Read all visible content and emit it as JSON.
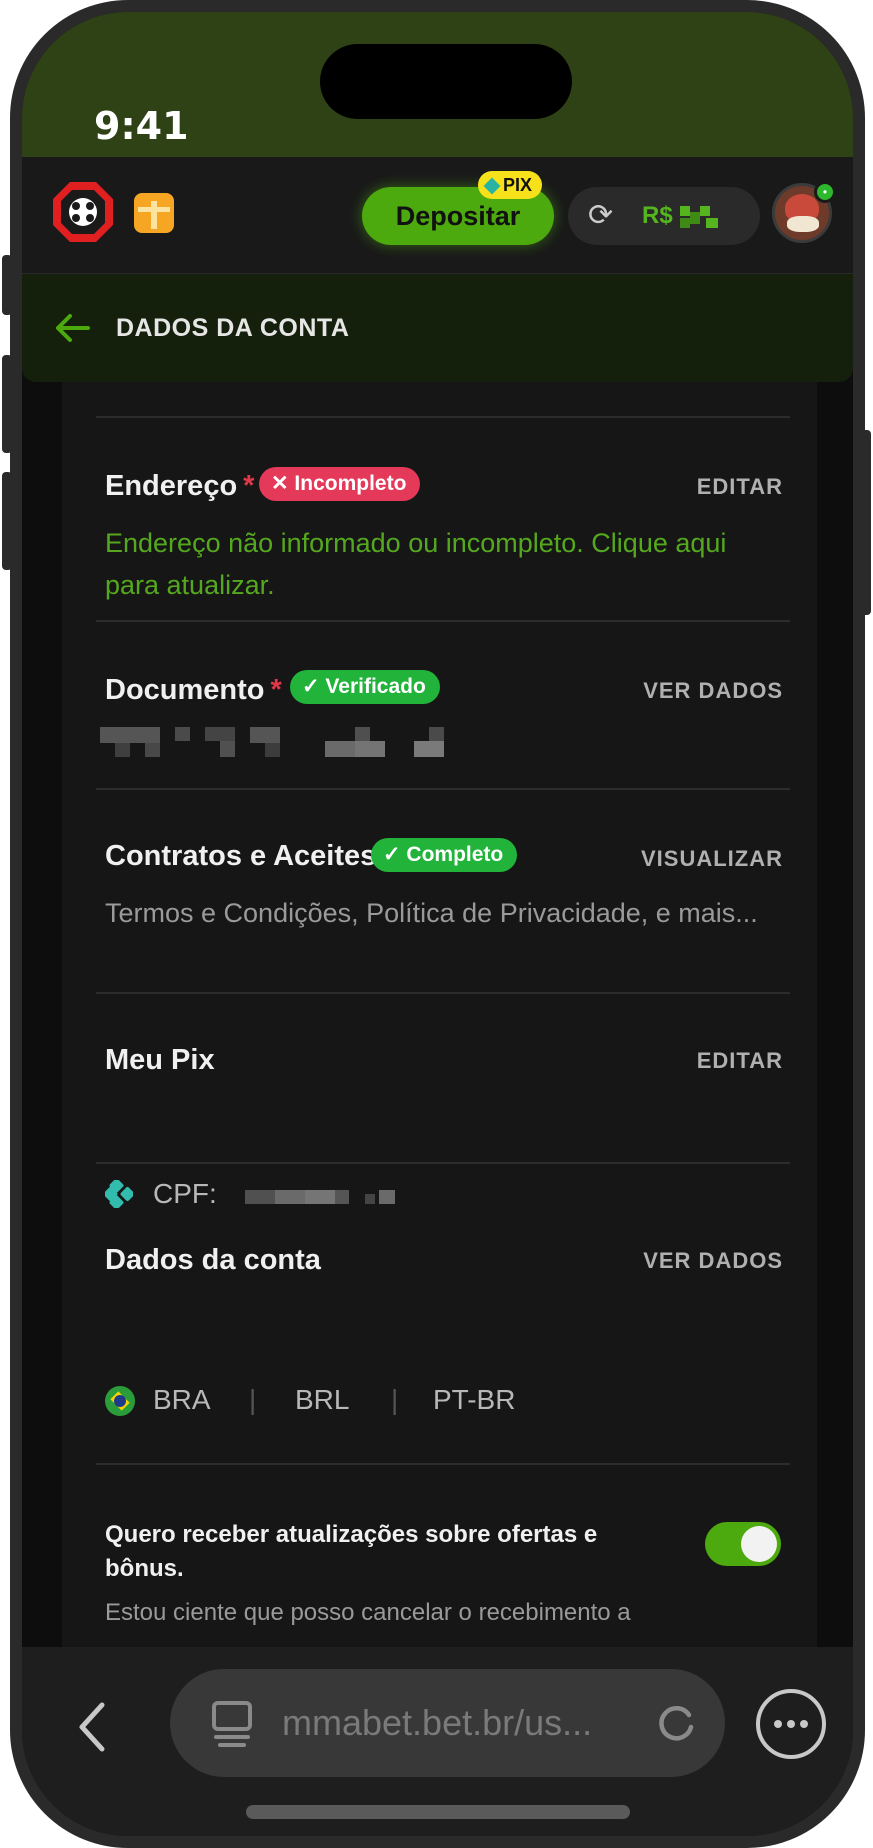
{
  "status_bar": {
    "time": "9:41"
  },
  "header": {
    "deposit_label": "Depositar",
    "pix_badge": "PIX",
    "balance_currency": "R$",
    "accent": "#4ca90e"
  },
  "section": {
    "title": "DADOS DA CONTA"
  },
  "cards": {
    "address": {
      "title": "Endereço",
      "required_mark": "*",
      "badge": "✕ Incompleto",
      "action": "EDITAR",
      "text": "Endereço não informado ou incompleto. Clique aqui para atualizar."
    },
    "document": {
      "title": "Documento",
      "required_mark": "*",
      "badge": "✓ Verificado",
      "action": "VER DADOS"
    },
    "contracts": {
      "title": "Contratos e Aceites",
      "badge": "✓ Completo",
      "action": "VISUALIZAR",
      "text": "Termos e Condições, Política de Privacidade, e mais..."
    },
    "pix": {
      "title": "Meu Pix",
      "action": "EDITAR",
      "key_label": "CPF:"
    },
    "account": {
      "title": "Dados da conta",
      "action": "VER DADOS",
      "country": "BRA",
      "currency": "BRL",
      "language": "PT-BR",
      "separator": "|"
    },
    "optin": {
      "title": "Quero receber atualizações sobre ofertas e bônus.",
      "text": "Estou ciente que posso cancelar o recebimento a",
      "toggle_on": true
    }
  },
  "browser": {
    "url": "mmabet.bet.br/us..."
  }
}
